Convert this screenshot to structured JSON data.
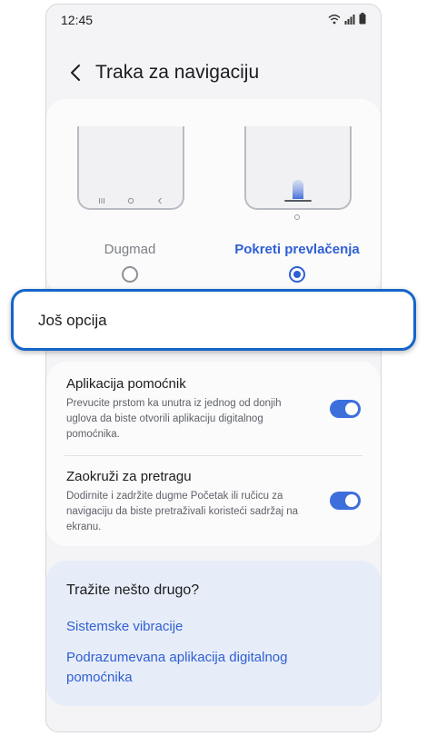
{
  "status": {
    "time": "12:45",
    "icons": [
      "wifi-icon",
      "signal-icon",
      "battery-icon"
    ]
  },
  "header": {
    "back_icon": "chevron-left-icon",
    "title": "Traka za navigaciju"
  },
  "navigation_type": {
    "options": [
      {
        "label": "Dugmad",
        "selected": false
      },
      {
        "label": "Pokreti prevlačenja",
        "selected": true
      }
    ]
  },
  "more_options": {
    "label": "Još opcija"
  },
  "settings": [
    {
      "title": "Aplikacija pomoćnik",
      "description": "Prevucite prstom ka unutra iz jednog od donjih uglova da biste otvorili aplikaciju digitalnog pomoćnika.",
      "enabled": true
    },
    {
      "title": "Zaokruži za pretragu",
      "description": "Dodirnite i zadržite dugme Početak ili ručicu za navigaciju da biste pretraživali koristeći sadržaj na ekranu.",
      "enabled": true
    }
  ],
  "suggestions": {
    "title": "Tražite nešto drugo?",
    "links": [
      "Sistemske vibracije",
      "Podrazumevana aplikacija digitalnog pomoćnika"
    ]
  },
  "colors": {
    "accent": "#2f5fd4",
    "highlight_border": "#1565c9",
    "toggle_on": "#3d6fdc",
    "suggestion_bg": "#e7edf8"
  }
}
